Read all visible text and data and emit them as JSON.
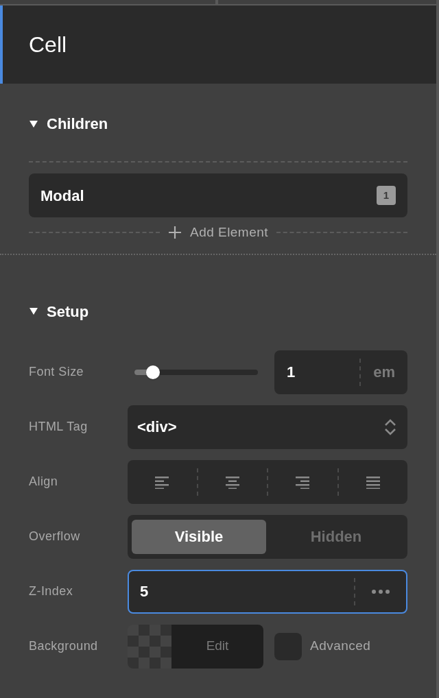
{
  "panel": {
    "title": "Cell"
  },
  "children_section": {
    "title": "Children",
    "expanded": true,
    "items": [
      {
        "label": "Modal",
        "count": "1"
      }
    ],
    "add_label": "Add Element"
  },
  "setup_section": {
    "title": "Setup",
    "expanded": true,
    "font_size": {
      "label": "Font Size",
      "level": 0.15,
      "value": "1",
      "unit": "em"
    },
    "html_tag": {
      "label": "HTML Tag",
      "value": "<div>"
    },
    "align": {
      "label": "Align",
      "options": [
        {
          "kind": "left",
          "selected": false
        },
        {
          "kind": "center",
          "selected": false
        },
        {
          "kind": "right",
          "selected": false
        },
        {
          "kind": "justify",
          "selected": false
        }
      ]
    },
    "overflow": {
      "label": "Overflow",
      "options": [
        {
          "label": "Visible",
          "selected": true
        },
        {
          "label": "Hidden",
          "selected": false
        }
      ]
    },
    "z_index": {
      "label": "Z-Index",
      "value": "5",
      "focused": true
    },
    "background": {
      "label": "Background",
      "edit_label": "Edit",
      "advanced": {
        "label": "Advanced",
        "checked": false
      }
    }
  }
}
